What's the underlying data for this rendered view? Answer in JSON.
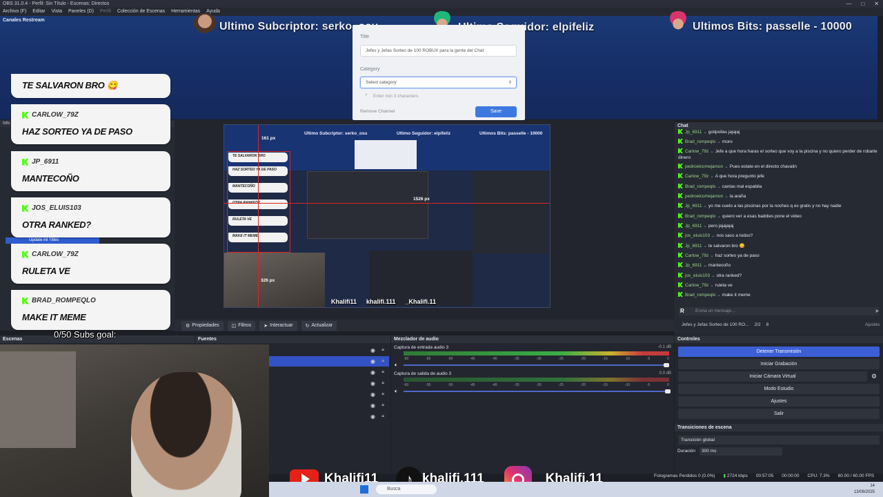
{
  "window": {
    "title": "OBS 31.0.4 - Perfil: Sin Título - Escenas: Directos",
    "controls": [
      "—",
      "□",
      "✕"
    ]
  },
  "menu": [
    "Archivo (F)",
    "Editar",
    "Vista",
    "Paneles (D)",
    "Perfil",
    "Colección de Escenas",
    "Herramientas",
    "Ayuda"
  ],
  "banner": {
    "label": "Canales Restream",
    "alerts": [
      {
        "text": "Ultimo Subcriptor: serko_osu",
        "icon": "avatar-icon"
      },
      {
        "text": "Ultimo Seguidor: elpifeliz",
        "icon": "avatar-icon"
      },
      {
        "text": "Ultimos Bits: passelle - 10000",
        "icon": "avatar-icon"
      }
    ]
  },
  "modal": {
    "title_label": "Title",
    "title_value": "Jefes y Jefas Sorteo de 100 ROBUX para la gente del Chat",
    "category_label": "Category",
    "category_placeholder": "Select category",
    "search_placeholder": "Enter min 3 characters",
    "remove_label": "Remove Channel",
    "save_label": "Save"
  },
  "bubbles": [
    {
      "user": "",
      "msg": "TE SALVARON BRO 😋"
    },
    {
      "user": "CARLOW_79Z",
      "msg": "HAZ SORTEO YA DE PASO"
    },
    {
      "user": "JP_6911",
      "msg": "MANTECOÑO"
    },
    {
      "user": "JOS_ELUIS103",
      "msg": "OTRA RANKED?"
    },
    {
      "user": "CARLOW_79Z",
      "msg": "RULETA VE"
    },
    {
      "user": "BRAD_ROMPEQLO",
      "msg": "MAKE IT MEME"
    }
  ],
  "left_dock": {
    "header": "Info",
    "update_titles": "Update All Titles"
  },
  "goal_text": "0/50 Subs goal:",
  "preview": {
    "mini_alerts": [
      "Ultimo Subcriptor: serko_osu",
      "Ultimo Seguidor: elpifeliz",
      "Ultimos Bits: passelle - 10000"
    ],
    "px_top": "161 px",
    "px_right": "1526 px",
    "px_bottom": "326 px",
    "mini_bubbles": [
      "TE SALVARON BRO",
      "HAZ SORTEO YA DE PASO",
      "MANTECOÑO",
      "OTRA RANKED?",
      "RULETA VE",
      "MAKE IT MEME"
    ],
    "socials": [
      "Khalifi11",
      "khalifi.111",
      "_Khalifi.11"
    ]
  },
  "props_bar": {
    "properties": "Propiedades",
    "filters": "Filtros",
    "interact": "Interactuar",
    "refresh": "Actualizar"
  },
  "docks": {
    "scenes": "Escenas",
    "sources": "Fuentes",
    "mixer": "Mezclador de audio",
    "controls": "Controles",
    "chat": "Chat",
    "transitions": "Transiciones de escena"
  },
  "mixer": {
    "tracks": [
      {
        "name": "Captura de entrada audio 3",
        "db": "-0.1 dB"
      },
      {
        "name": "Captura de salida de audio 3",
        "db": "0.0 dB"
      }
    ],
    "scale": [
      "-60",
      "-55",
      "-50",
      "-45",
      "-40",
      "-35",
      "-30",
      "-25",
      "-20",
      "-15",
      "-10",
      "-5",
      "0"
    ]
  },
  "controls": {
    "buttons": [
      "Detener Transmisión",
      "Iniciar Grabación",
      "Iniciar Cámara Virtual",
      "Modo Estudio",
      "Ajustes",
      "Salir"
    ]
  },
  "transitions": {
    "value": "Transición global",
    "duration_label": "Duración",
    "duration_value": "300 ms"
  },
  "chat": {
    "lines": [
      {
        "user": "Jp_6911",
        "msg": "golipollas jajajaj"
      },
      {
        "user": "Brad_rompeqlo",
        "msg": "moro"
      },
      {
        "user": "Carlow_79z",
        "msg": "Jefe a que hora haras el sorteo que voy a la piscina y no quiero perder de robarte dinero"
      },
      {
        "user": "pedroelcomejamon",
        "msg": "Pues estate en el directo chavalin"
      },
      {
        "user": "Carlow_79z",
        "msg": "A que hora pregunto jefe"
      },
      {
        "user": "Brad_rompeqlo",
        "msg": "cantas mal espabila"
      },
      {
        "user": "pedroelcomejamon",
        "msg": "la araña"
      },
      {
        "user": "Jp_6911",
        "msg": "yo me cuelo a las piscinas por la noches q es gratis y no hay nadie"
      },
      {
        "user": "Brad_rompeqlo",
        "msg": "quiero ver a esas baddies pone el video"
      },
      {
        "user": "Jp_6911",
        "msg": "pero jajajajaj"
      },
      {
        "user": "jos_eluis103",
        "msg": "nos saco a todos?"
      },
      {
        "user": "Jp_6911",
        "msg": "te salvaron bro 😋"
      },
      {
        "user": "Carlow_79z",
        "msg": "haz sorteo ya de paso"
      },
      {
        "user": "Jp_6911",
        "msg": "mantecoño"
      },
      {
        "user": "jos_eluis103",
        "msg": "otra ranked?"
      },
      {
        "user": "Carlow_79z",
        "msg": "ruleta ve"
      },
      {
        "user": "Brad_rompeqlo",
        "msg": "make it meme"
      }
    ],
    "input_placeholder": "Envía un mensaje...",
    "stream_title": "Jefes y Jefas Sorteo de 100 RO...",
    "viewers": "2/2",
    "watchers": "8",
    "settings": "Ajustes"
  },
  "socials": [
    "Khalifi11",
    "khalifi.111",
    "_Khalifi.11"
  ],
  "status": {
    "dropped": "Fotogramas Perdidos 0 (0.0%)",
    "bitrate": "2724 kbps",
    "live_time": "00:57:05",
    "rec_time": "00:00:00",
    "cpu": "CPU: 7.3%",
    "fps": "60.00 / 60.00 FPS"
  },
  "taskbar": {
    "search": "Busca",
    "clock": "14",
    "date": "13/08/2025"
  },
  "colors": {
    "accent": "#3c5fd6",
    "kick_green": "#53fc18",
    "banner_blue": "#1b3a76"
  }
}
